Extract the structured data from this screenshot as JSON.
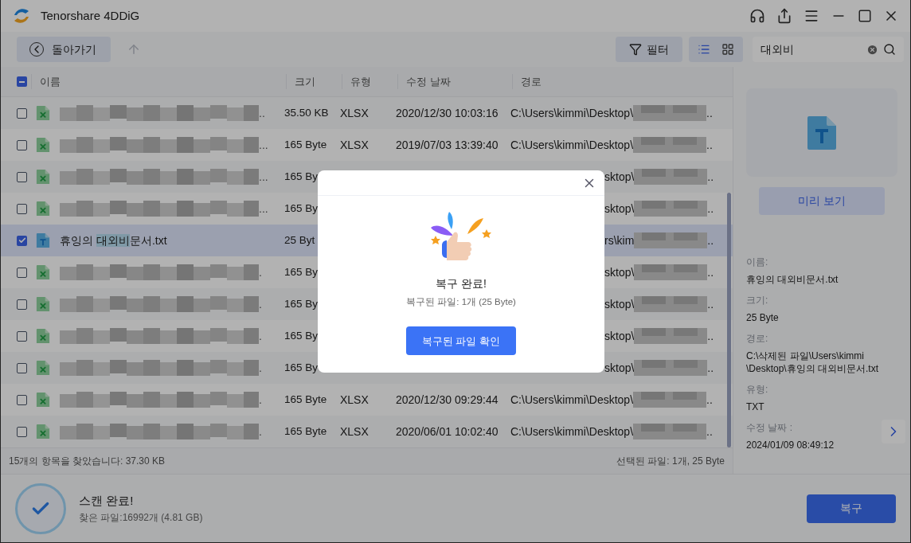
{
  "window": {
    "title": "Tenorshare 4DDiG"
  },
  "toolbar": {
    "back": "돌아가기",
    "filter": "필터",
    "views": [
      {
        "kind": "list",
        "selected": true
      },
      {
        "kind": "grid",
        "selected": false
      }
    ],
    "search": {
      "value": "대외비"
    }
  },
  "table": {
    "all_indeterminate": true,
    "columns": [
      "이름",
      "크기",
      "유형",
      "수정 날짜",
      "경로"
    ],
    "rows": [
      {
        "kind": "xlsx",
        "checked": false,
        "covered": false,
        "name": "..",
        "size": "35.50 KB",
        "type": "XLSX",
        "date": "2020/12/30 10:03:16",
        "path": "C:\\Users\\kimmi\\Desktop\\",
        "path_end": ".."
      },
      {
        "kind": "xlsx",
        "checked": false,
        "covered": false,
        "name": "...",
        "size": "165 Byte",
        "type": "XLSX",
        "date": "2019/07/03 13:39:40",
        "path": "C:\\Users\\kimmi\\Desktop\\",
        "path_end": ".."
      },
      {
        "kind": "xlsx",
        "checked": false,
        "covered": true,
        "name": "...",
        "size": "165 By",
        "path": "sktop\\",
        "path_end": ".."
      },
      {
        "kind": "xlsx",
        "checked": false,
        "covered": true,
        "name": "...",
        "size": "165 By",
        "path": "sktop\\",
        "path_end": ".."
      },
      {
        "kind": "txt",
        "checked": true,
        "covered": true,
        "name_parts": [
          "휴잉의 ",
          "대외비",
          "문서.txt"
        ],
        "size": "25 Byt",
        "path": "rs\\kim",
        "path_end": ".."
      },
      {
        "kind": "xlsx",
        "checked": false,
        "covered": true,
        "name": ".",
        "size": "165 By",
        "path": "sktop\\",
        "path_end": ".."
      },
      {
        "kind": "xlsx",
        "checked": false,
        "covered": true,
        "name": ".",
        "size": "165 By",
        "path": "sktop\\",
        "path_end": ".."
      },
      {
        "kind": "xlsx",
        "checked": false,
        "covered": true,
        "name": ".",
        "size": "165 By",
        "path": "sktop\\",
        "path_end": ".."
      },
      {
        "kind": "xlsx",
        "checked": false,
        "covered": true,
        "name": ".",
        "size": "165 By",
        "path": "sktop\\",
        "path_end": ".."
      },
      {
        "kind": "xlsx",
        "checked": false,
        "covered": false,
        "name": ".",
        "size": "165 Byte",
        "type": "XLSX",
        "date": "2020/12/30 09:29:44",
        "path": "C:\\Users\\kimmi\\Desktop\\",
        "path_end": ".."
      },
      {
        "kind": "xlsx",
        "checked": false,
        "covered": false,
        "name": ".",
        "size": "165 Byte",
        "type": "XLSX",
        "date": "2020/06/01 10:02:40",
        "path": "C:\\Users\\kimmi\\Desktop\\",
        "path_end": ".."
      }
    ]
  },
  "status_bar": {
    "found": "15개의 항목을 찾았습니다: 37.30 KB",
    "selected": "선택된 파일: 1개, 25 Byte"
  },
  "details": {
    "preview_button": "미리 보기",
    "fields": [
      {
        "label": "이름:",
        "value": "휴잉의 대외비문서.txt"
      },
      {
        "label": "크기:",
        "value": "25 Byte"
      },
      {
        "label": "경로:",
        "value": "C:\\삭제된 파일\\Users\\kimmi\n\\Desktop\\휴잉의 대외비문서.txt"
      },
      {
        "label": "유형:",
        "value": "TXT"
      },
      {
        "label": "수정 날짜 :",
        "value": "2024/01/09 08:49:12"
      }
    ]
  },
  "scan": {
    "title": "스캔 완료!",
    "summary": "찾은 파일:16992개 (4.81 GB)",
    "recover_button": "복구"
  },
  "dialog": {
    "title": "복구 완료!",
    "summary": "복구된 파일: 1개 (25 Byte)",
    "button": "복구된 파일 확인"
  }
}
